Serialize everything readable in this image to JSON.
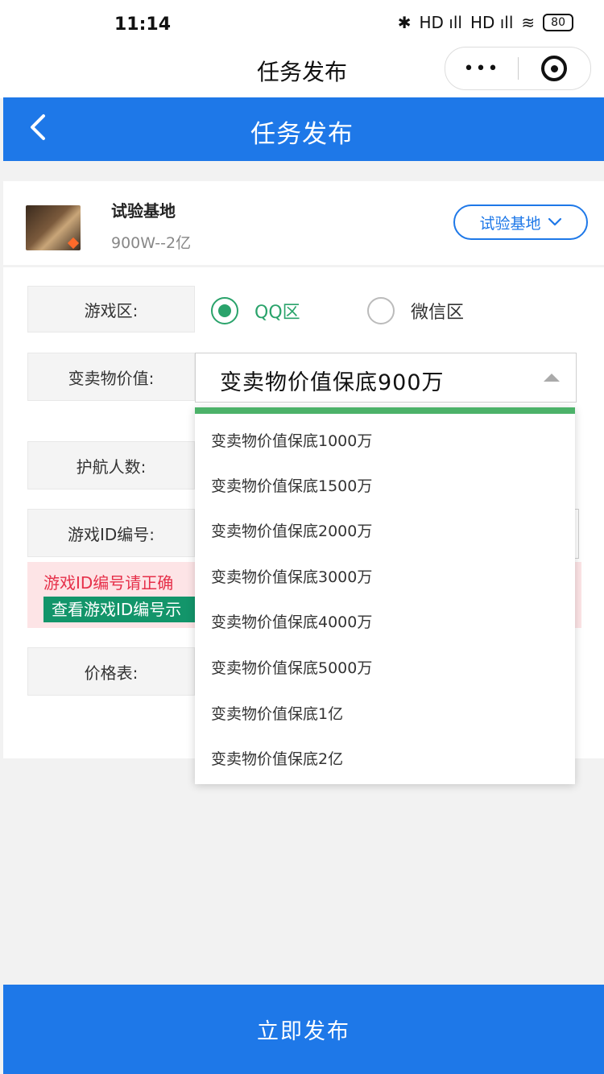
{
  "status_bar": {
    "time": "11:14",
    "bluetooth": "✱",
    "signal1": "HD ıll",
    "signal2": "HD ıll",
    "wifi": "≋",
    "battery": "80"
  },
  "wechat": {
    "title": "任务发布",
    "more": "•••"
  },
  "header": {
    "title": "任务发布",
    "back": "<"
  },
  "game": {
    "name": "试验基地",
    "range": "900W--2亿",
    "select_label": "试验基地",
    "chevron": "∨"
  },
  "form": {
    "game_zone_label": "游戏区:",
    "radio_qq": "QQ区",
    "radio_wechat": "微信区",
    "value_label": "变卖物价值:",
    "value_selected": "变卖物价值保底900万",
    "escort_label": "护航人数:",
    "game_id_label": "游戏ID编号:",
    "warn_text": "游戏ID编号请正确",
    "warn_button": "查看游戏ID编号示",
    "price_label": "价格表:"
  },
  "dropdown": {
    "options": [
      "变卖物价值保底1000万",
      "变卖物价值保底1500万",
      "变卖物价值保底2000万",
      "变卖物价值保底3000万",
      "变卖物价值保底4000万",
      "变卖物价值保底5000万",
      "变卖物价值保底1亿",
      "变卖物价值保底2亿"
    ]
  },
  "submit": {
    "label": "立即发布"
  },
  "colors": {
    "primary": "#1e78e8",
    "green": "#2aa36b",
    "warn": "#e6304a"
  }
}
